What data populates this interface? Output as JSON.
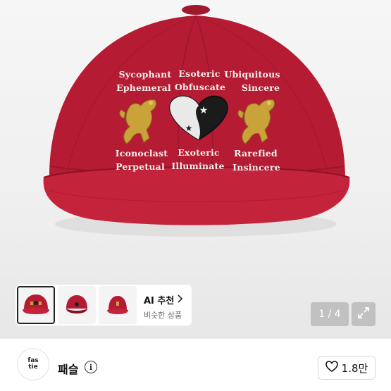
{
  "product_image": {
    "alt": "",
    "embroidery": {
      "row1": [
        "Sycophant",
        "Esoteric",
        "Ubiquitous"
      ],
      "row2": [
        "Ephemeral",
        "Obfuscate",
        "Sincere"
      ],
      "row3": [
        "Iconoclast",
        "Exoteric",
        "Rarefied"
      ],
      "row4": [
        "Perpetual",
        "Illuminate",
        "Insincere"
      ]
    },
    "colors": {
      "cap": "#b51c34",
      "cap_dark": "#8c1326",
      "gold": "#c9a23a"
    }
  },
  "thumbnails": [
    {
      "name": "thumb-cap-front"
    },
    {
      "name": "thumb-cap-top"
    },
    {
      "name": "thumb-cap-side"
    }
  ],
  "ai_recommend": {
    "title": "AI 추천",
    "chevron": "chevron-right-icon",
    "subtitle": "비슷한 상품"
  },
  "gallery": {
    "counter": "1 / 4",
    "expand_icon": "expand-icon"
  },
  "seller": {
    "avatar_text_top": "fas",
    "avatar_text_bottom": "tie",
    "name": "패슬",
    "info_icon_label": "i"
  },
  "like": {
    "icon": "heart-outline-icon",
    "count": "1.8만"
  }
}
